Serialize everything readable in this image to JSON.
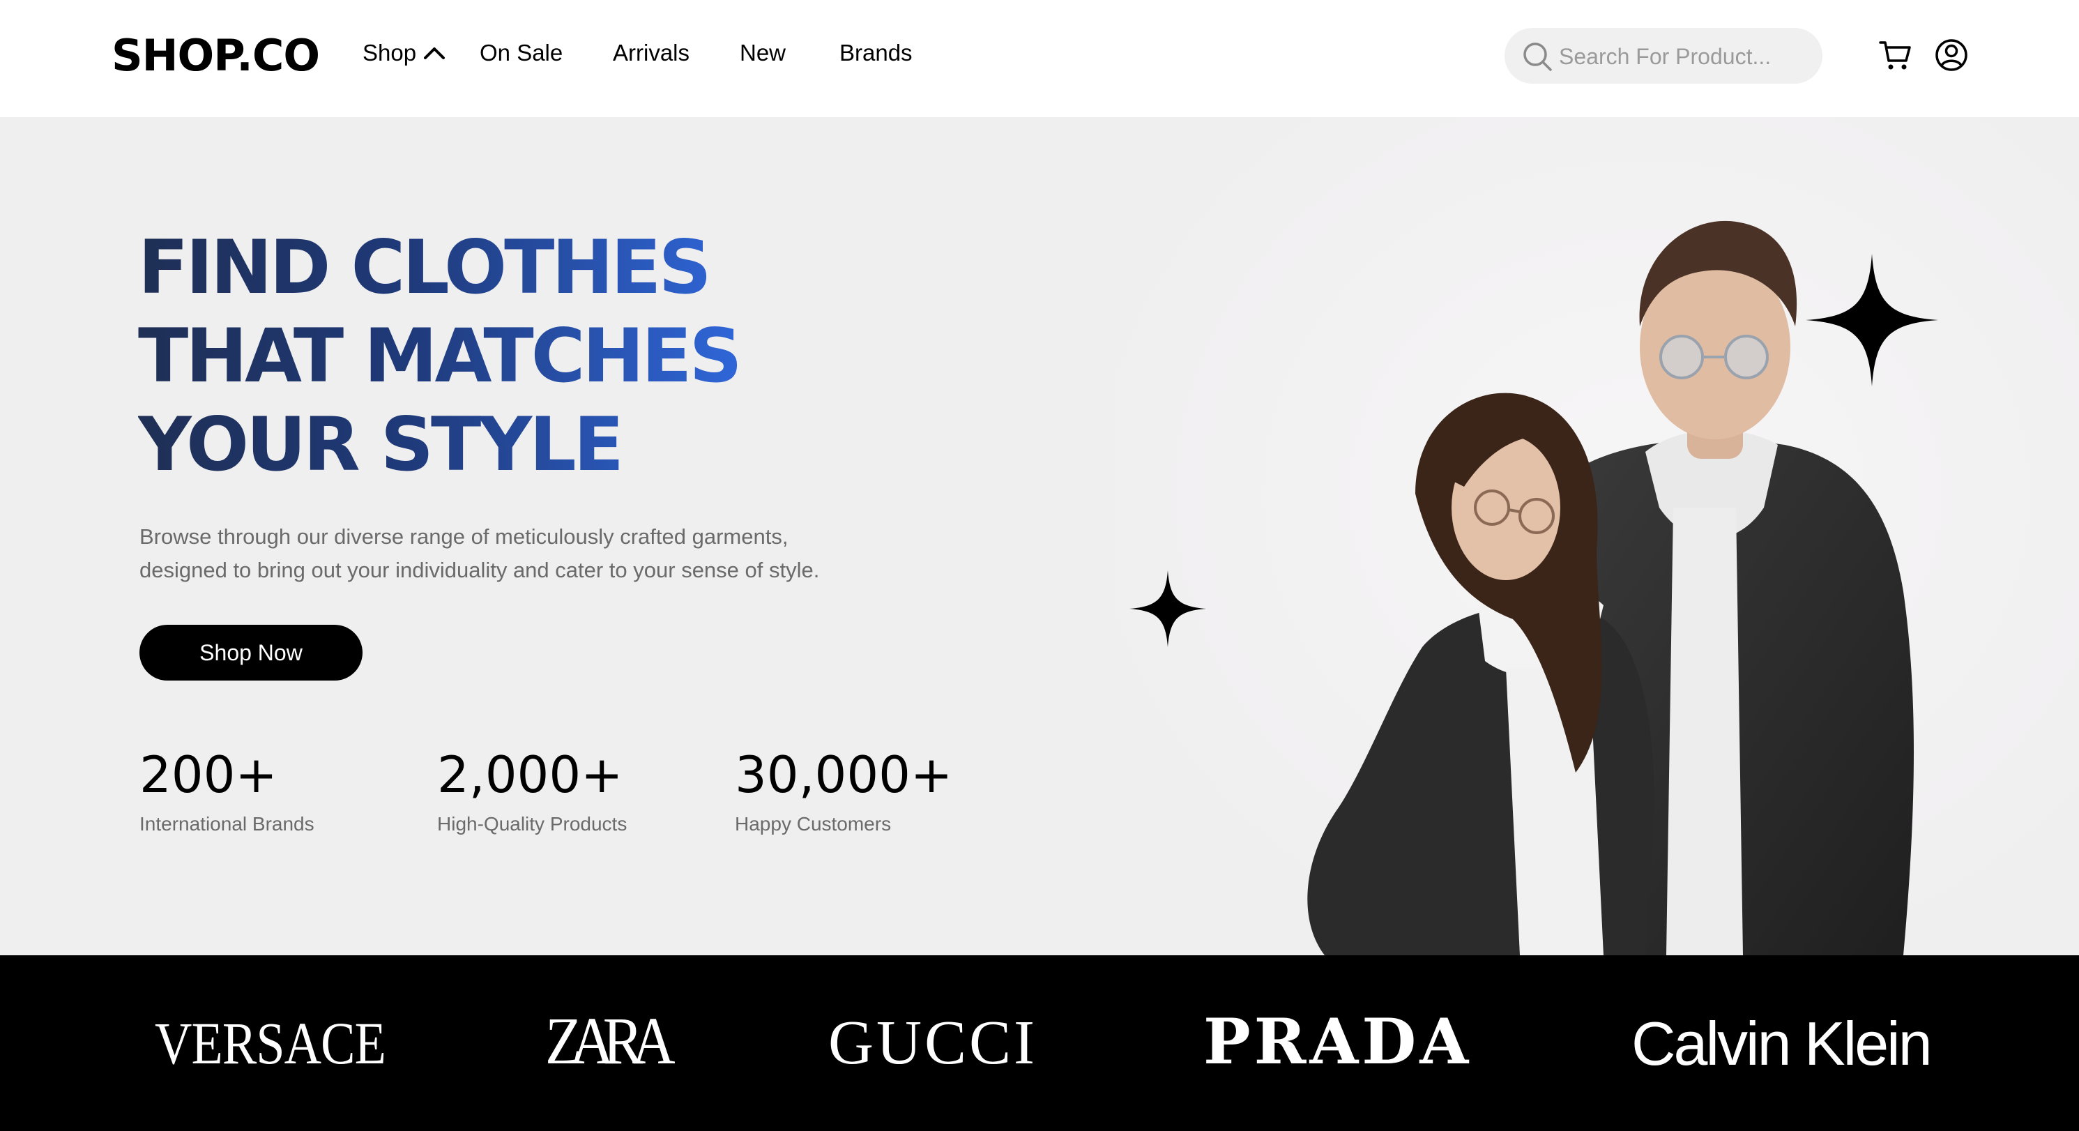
{
  "header": {
    "logo": "SHOP.CO",
    "nav": {
      "shop": "Shop",
      "on_sale": "On Sale",
      "arrivals": "Arrivals",
      "new": "New",
      "brands": "Brands"
    },
    "search_placeholder": "Search For Product...",
    "icons": [
      "chevron-up-icon",
      "search-icon",
      "cart-icon",
      "account-icon"
    ]
  },
  "hero": {
    "title_lines": [
      "FIND CLOTHES",
      "THAT MATCHES",
      "YOUR STYLE"
    ],
    "subtitle": "Browse through our diverse range of meticulously crafted garments, designed to bring out your individuality and cater to your sense of style.",
    "cta_label": "Shop Now",
    "stats": [
      {
        "value": "200+",
        "label": "International Brands"
      },
      {
        "value": "2,000+",
        "label": "High-Quality Products"
      },
      {
        "value": "30,000+",
        "label": "Happy Customers"
      }
    ],
    "icons": [
      "sparkle-icon"
    ]
  },
  "brands": [
    "VERSACE",
    "ZARA",
    "GUCCI",
    "PRADA",
    "Calvin Klein"
  ],
  "colors": {
    "title_dark": "#1f2f55",
    "title_blue": "#2f66d8",
    "hero_bg": "#f0eff0",
    "brand_bar_bg": "#000000",
    "button_bg": "#000000",
    "search_bg": "#f0f0f0"
  }
}
